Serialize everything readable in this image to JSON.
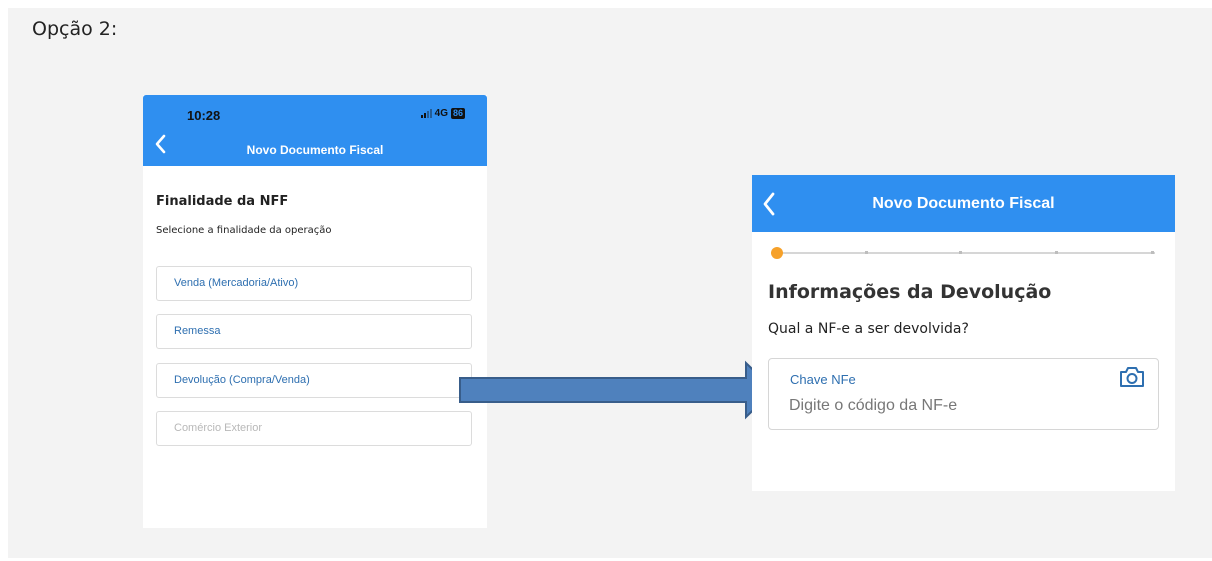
{
  "page_label": "Opção 2:",
  "screen1": {
    "status_time": "10:28",
    "status_network": "4G",
    "status_battery": "86",
    "header_title": "Novo Documento Fiscal",
    "heading": "Finalidade da NFF",
    "subtitle": "Selecione a finalidade da operação",
    "options": [
      {
        "label": "Venda (Mercadoria/Ativo)",
        "enabled": true
      },
      {
        "label": "Remessa",
        "enabled": true
      },
      {
        "label": "Devolução (Compra/Venda)",
        "enabled": true
      },
      {
        "label": "Comércio Exterior",
        "enabled": false
      }
    ]
  },
  "screen2": {
    "header_title": "Novo Documento Fiscal",
    "step_current": 1,
    "step_total": 5,
    "heading": "Informações da Devolução",
    "question": "Qual a NF-e a ser devolvida?",
    "field_label": "Chave NFe",
    "field_placeholder": "Digite o código da NF-e",
    "field_value": ""
  },
  "colors": {
    "header_blue": "#2f8ff0",
    "link_blue": "#2e6fb0",
    "step_orange": "#f6a12a",
    "arrow_fill": "#4f81bd",
    "arrow_stroke": "#385d8a"
  },
  "icons": [
    "chevron-left-icon",
    "signal-icon",
    "battery-icon",
    "camera-icon",
    "arrow-right-icon"
  ]
}
